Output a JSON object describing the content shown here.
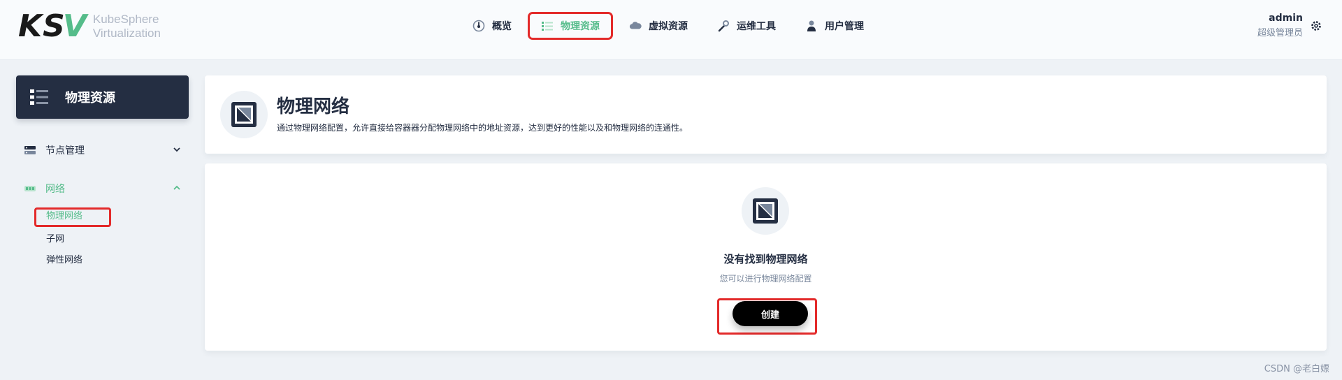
{
  "brand": {
    "line1": "KubeSphere",
    "line2": "Virtualization"
  },
  "nav": [
    {
      "label": "概览",
      "icon": "dashboard-icon"
    },
    {
      "label": "物理资源",
      "icon": "list-icon",
      "active": true
    },
    {
      "label": "虚拟资源",
      "icon": "cloud-icon"
    },
    {
      "label": "运维工具",
      "icon": "wrench-icon"
    },
    {
      "label": "用户管理",
      "icon": "user-icon"
    }
  ],
  "user": {
    "name": "admin",
    "role": "超级管理员"
  },
  "sidebar": {
    "title": "物理资源",
    "groups": [
      {
        "label": "节点管理",
        "icon": "server-icon",
        "open": false
      },
      {
        "label": "网络",
        "icon": "network-icon",
        "open": true,
        "items": [
          {
            "label": "物理网络",
            "active": true
          },
          {
            "label": "子网"
          },
          {
            "label": "弹性网络"
          }
        ]
      }
    ]
  },
  "page": {
    "title": "物理网络",
    "description": "通过物理网络配置，允许直接给容器器分配物理网络中的地址资源，达到更好的性能以及和物理网络的连通性。"
  },
  "empty": {
    "title": "没有找到物理网络",
    "description": "您可以进行物理网络配置",
    "button": "创建"
  },
  "watermark": "CSDN @老白嫖",
  "colors": {
    "accent": "#55bc8a",
    "dark": "#242e42",
    "highlight": "#e32a2a"
  }
}
